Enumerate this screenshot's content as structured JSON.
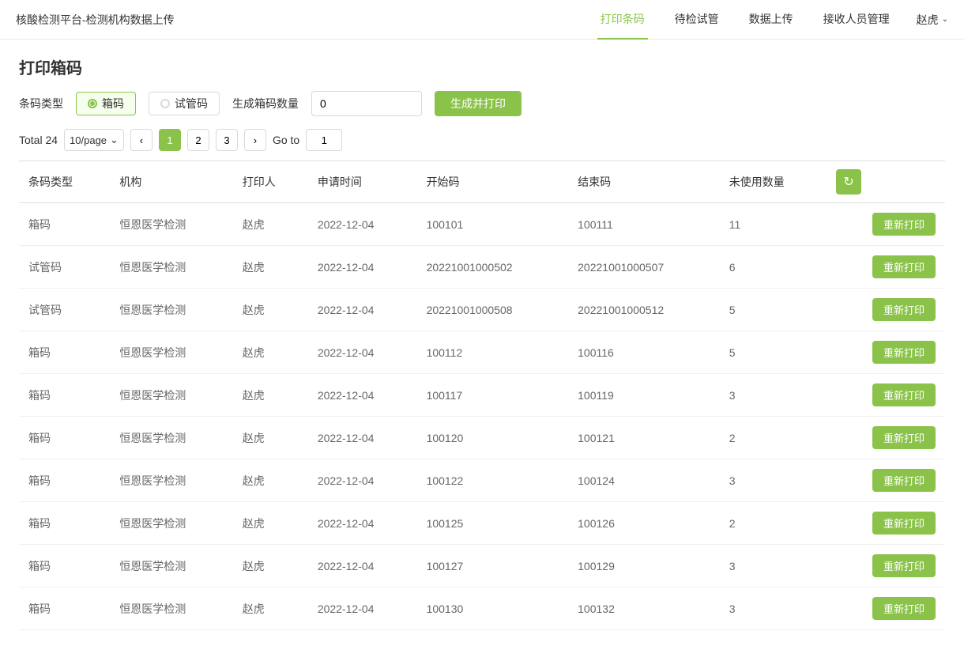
{
  "header": {
    "title": "核酸检测平台-检测机构数据上传",
    "nav": [
      {
        "label": "打印条码",
        "active": true
      },
      {
        "label": "待检试管",
        "active": false
      },
      {
        "label": "数据上传",
        "active": false
      },
      {
        "label": "接收人员管理",
        "active": false
      }
    ],
    "user": "赵虎"
  },
  "page": {
    "title": "打印箱码",
    "filter": {
      "barcode_type_label": "条码类型",
      "option_box": "箱码",
      "option_tube": "试管码",
      "qty_label": "生成箱码数量",
      "qty_value": "0",
      "gen_btn_label": "生成并打印"
    },
    "pagination": {
      "total_label": "Total 24",
      "page_size": "10/page",
      "pages": [
        "1",
        "2",
        "3"
      ],
      "current_page": "1",
      "goto_label": "Go to",
      "goto_value": "1"
    },
    "table": {
      "columns": [
        "条码类型",
        "机构",
        "打印人",
        "申请时间",
        "开始码",
        "结束码",
        "未使用数量",
        ""
      ],
      "rows": [
        {
          "type": "箱码",
          "org": "恒恩医学检测",
          "printer": "赵虎",
          "time": "2022-12-04",
          "start": "100101",
          "end": "100111",
          "unused": "11"
        },
        {
          "type": "试管码",
          "org": "恒恩医学检测",
          "printer": "赵虎",
          "time": "2022-12-04",
          "start": "20221001000502",
          "end": "20221001000507",
          "unused": "6"
        },
        {
          "type": "试管码",
          "org": "恒恩医学检测",
          "printer": "赵虎",
          "time": "2022-12-04",
          "start": "20221001000508",
          "end": "20221001000512",
          "unused": "5"
        },
        {
          "type": "箱码",
          "org": "恒恩医学检测",
          "printer": "赵虎",
          "time": "2022-12-04",
          "start": "100112",
          "end": "100116",
          "unused": "5"
        },
        {
          "type": "箱码",
          "org": "恒恩医学检测",
          "printer": "赵虎",
          "time": "2022-12-04",
          "start": "100117",
          "end": "100119",
          "unused": "3"
        },
        {
          "type": "箱码",
          "org": "恒恩医学检测",
          "printer": "赵虎",
          "time": "2022-12-04",
          "start": "100120",
          "end": "100121",
          "unused": "2"
        },
        {
          "type": "箱码",
          "org": "恒恩医学检测",
          "printer": "赵虎",
          "time": "2022-12-04",
          "start": "100122",
          "end": "100124",
          "unused": "3"
        },
        {
          "type": "箱码",
          "org": "恒恩医学检测",
          "printer": "赵虎",
          "time": "2022-12-04",
          "start": "100125",
          "end": "100126",
          "unused": "2"
        },
        {
          "type": "箱码",
          "org": "恒恩医学检测",
          "printer": "赵虎",
          "time": "2022-12-04",
          "start": "100127",
          "end": "100129",
          "unused": "3"
        },
        {
          "type": "箱码",
          "org": "恒恩医学检测",
          "printer": "赵虎",
          "time": "2022-12-04",
          "start": "100130",
          "end": "100132",
          "unused": "3"
        }
      ],
      "reprint_label": "重新打印"
    }
  }
}
